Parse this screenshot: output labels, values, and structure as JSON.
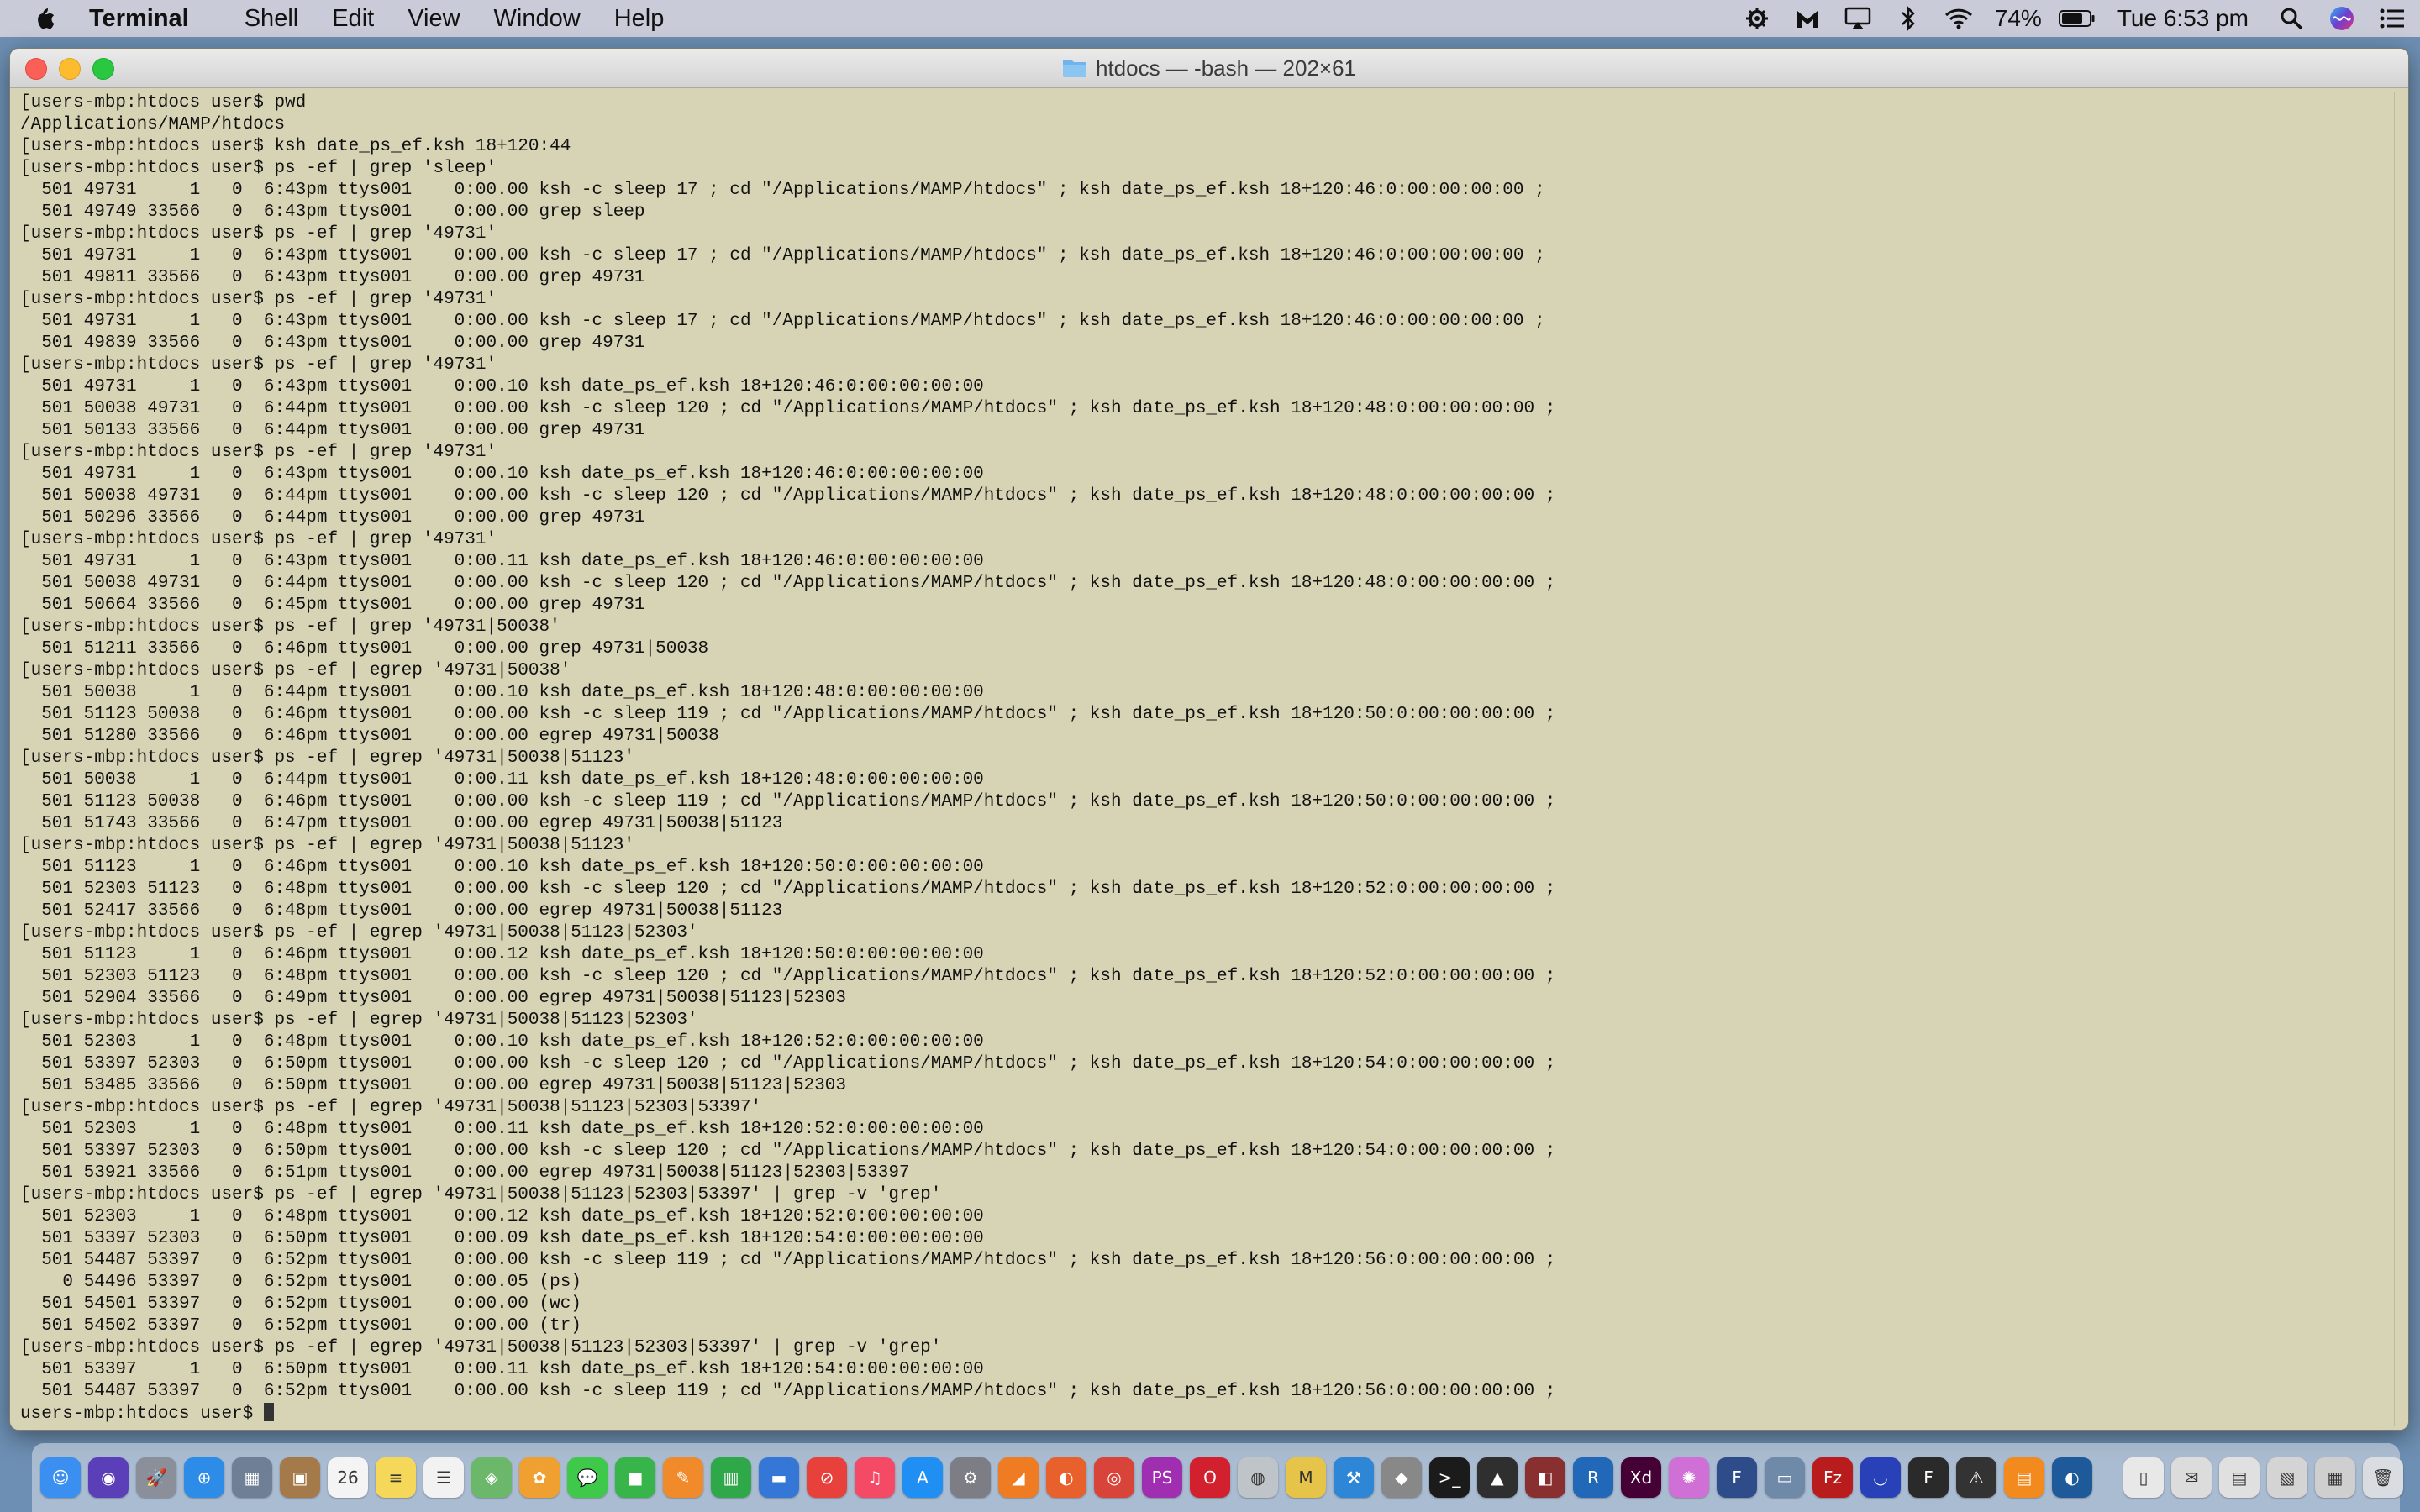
{
  "menubar": {
    "app_name": "Terminal",
    "menus": [
      "Shell",
      "Edit",
      "View",
      "Window",
      "Help"
    ],
    "battery": "74%",
    "clock": "Tue 6:53 pm",
    "status_icons": [
      "gear-status-icon",
      "malwarebytes-icon",
      "airplay-icon",
      "bluetooth-icon",
      "wifi-icon",
      "battery-icon",
      "spotlight-icon",
      "siri-icon",
      "notification-center-icon"
    ]
  },
  "window": {
    "title": "htdocs — -bash — 202×61"
  },
  "terminal": {
    "lines": [
      "[users-mbp:htdocs user$ pwd",
      "/Applications/MAMP/htdocs",
      "[users-mbp:htdocs user$ ksh date_ps_ef.ksh 18+120:44",
      "[users-mbp:htdocs user$ ps -ef | grep 'sleep'",
      "  501 49731     1   0  6:43pm ttys001    0:00.00 ksh -c sleep 17 ; cd \"/Applications/MAMP/htdocs\" ; ksh date_ps_ef.ksh 18+120:46:0:00:00:00:00 ;",
      "  501 49749 33566   0  6:43pm ttys001    0:00.00 grep sleep",
      "[users-mbp:htdocs user$ ps -ef | grep '49731'",
      "  501 49731     1   0  6:43pm ttys001    0:00.00 ksh -c sleep 17 ; cd \"/Applications/MAMP/htdocs\" ; ksh date_ps_ef.ksh 18+120:46:0:00:00:00:00 ;",
      "  501 49811 33566   0  6:43pm ttys001    0:00.00 grep 49731",
      "[users-mbp:htdocs user$ ps -ef | grep '49731'",
      "  501 49731     1   0  6:43pm ttys001    0:00.00 ksh -c sleep 17 ; cd \"/Applications/MAMP/htdocs\" ; ksh date_ps_ef.ksh 18+120:46:0:00:00:00:00 ;",
      "  501 49839 33566   0  6:43pm ttys001    0:00.00 grep 49731",
      "[users-mbp:htdocs user$ ps -ef | grep '49731'",
      "  501 49731     1   0  6:43pm ttys001    0:00.10 ksh date_ps_ef.ksh 18+120:46:0:00:00:00:00",
      "  501 50038 49731   0  6:44pm ttys001    0:00.00 ksh -c sleep 120 ; cd \"/Applications/MAMP/htdocs\" ; ksh date_ps_ef.ksh 18+120:48:0:00:00:00:00 ;",
      "  501 50133 33566   0  6:44pm ttys001    0:00.00 grep 49731",
      "[users-mbp:htdocs user$ ps -ef | grep '49731'",
      "  501 49731     1   0  6:43pm ttys001    0:00.10 ksh date_ps_ef.ksh 18+120:46:0:00:00:00:00",
      "  501 50038 49731   0  6:44pm ttys001    0:00.00 ksh -c sleep 120 ; cd \"/Applications/MAMP/htdocs\" ; ksh date_ps_ef.ksh 18+120:48:0:00:00:00:00 ;",
      "  501 50296 33566   0  6:44pm ttys001    0:00.00 grep 49731",
      "[users-mbp:htdocs user$ ps -ef | grep '49731'",
      "  501 49731     1   0  6:43pm ttys001    0:00.11 ksh date_ps_ef.ksh 18+120:46:0:00:00:00:00",
      "  501 50038 49731   0  6:44pm ttys001    0:00.00 ksh -c sleep 120 ; cd \"/Applications/MAMP/htdocs\" ; ksh date_ps_ef.ksh 18+120:48:0:00:00:00:00 ;",
      "  501 50664 33566   0  6:45pm ttys001    0:00.00 grep 49731",
      "[users-mbp:htdocs user$ ps -ef | grep '49731|50038'",
      "  501 51211 33566   0  6:46pm ttys001    0:00.00 grep 49731|50038",
      "[users-mbp:htdocs user$ ps -ef | egrep '49731|50038'",
      "  501 50038     1   0  6:44pm ttys001    0:00.10 ksh date_ps_ef.ksh 18+120:48:0:00:00:00:00",
      "  501 51123 50038   0  6:46pm ttys001    0:00.00 ksh -c sleep 119 ; cd \"/Applications/MAMP/htdocs\" ; ksh date_ps_ef.ksh 18+120:50:0:00:00:00:00 ;",
      "  501 51280 33566   0  6:46pm ttys001    0:00.00 egrep 49731|50038",
      "[users-mbp:htdocs user$ ps -ef | egrep '49731|50038|51123'",
      "  501 50038     1   0  6:44pm ttys001    0:00.11 ksh date_ps_ef.ksh 18+120:48:0:00:00:00:00",
      "  501 51123 50038   0  6:46pm ttys001    0:00.00 ksh -c sleep 119 ; cd \"/Applications/MAMP/htdocs\" ; ksh date_ps_ef.ksh 18+120:50:0:00:00:00:00 ;",
      "  501 51743 33566   0  6:47pm ttys001    0:00.00 egrep 49731|50038|51123",
      "[users-mbp:htdocs user$ ps -ef | egrep '49731|50038|51123'",
      "  501 51123     1   0  6:46pm ttys001    0:00.10 ksh date_ps_ef.ksh 18+120:50:0:00:00:00:00",
      "  501 52303 51123   0  6:48pm ttys001    0:00.00 ksh -c sleep 120 ; cd \"/Applications/MAMP/htdocs\" ; ksh date_ps_ef.ksh 18+120:52:0:00:00:00:00 ;",
      "  501 52417 33566   0  6:48pm ttys001    0:00.00 egrep 49731|50038|51123",
      "[users-mbp:htdocs user$ ps -ef | egrep '49731|50038|51123|52303'",
      "  501 51123     1   0  6:46pm ttys001    0:00.12 ksh date_ps_ef.ksh 18+120:50:0:00:00:00:00",
      "  501 52303 51123   0  6:48pm ttys001    0:00.00 ksh -c sleep 120 ; cd \"/Applications/MAMP/htdocs\" ; ksh date_ps_ef.ksh 18+120:52:0:00:00:00:00 ;",
      "  501 52904 33566   0  6:49pm ttys001    0:00.00 egrep 49731|50038|51123|52303",
      "[users-mbp:htdocs user$ ps -ef | egrep '49731|50038|51123|52303'",
      "  501 52303     1   0  6:48pm ttys001    0:00.10 ksh date_ps_ef.ksh 18+120:52:0:00:00:00:00",
      "  501 53397 52303   0  6:50pm ttys001    0:00.00 ksh -c sleep 120 ; cd \"/Applications/MAMP/htdocs\" ; ksh date_ps_ef.ksh 18+120:54:0:00:00:00:00 ;",
      "  501 53485 33566   0  6:50pm ttys001    0:00.00 egrep 49731|50038|51123|52303",
      "[users-mbp:htdocs user$ ps -ef | egrep '49731|50038|51123|52303|53397'",
      "  501 52303     1   0  6:48pm ttys001    0:00.11 ksh date_ps_ef.ksh 18+120:52:0:00:00:00:00",
      "  501 53397 52303   0  6:50pm ttys001    0:00.00 ksh -c sleep 120 ; cd \"/Applications/MAMP/htdocs\" ; ksh date_ps_ef.ksh 18+120:54:0:00:00:00:00 ;",
      "  501 53921 33566   0  6:51pm ttys001    0:00.00 egrep 49731|50038|51123|52303|53397",
      "[users-mbp:htdocs user$ ps -ef | egrep '49731|50038|51123|52303|53397' | grep -v 'grep'",
      "  501 52303     1   0  6:48pm ttys001    0:00.12 ksh date_ps_ef.ksh 18+120:52:0:00:00:00:00",
      "  501 53397 52303   0  6:50pm ttys001    0:00.09 ksh date_ps_ef.ksh 18+120:54:0:00:00:00:00",
      "  501 54487 53397   0  6:52pm ttys001    0:00.00 ksh -c sleep 119 ; cd \"/Applications/MAMP/htdocs\" ; ksh date_ps_ef.ksh 18+120:56:0:00:00:00:00 ;",
      "    0 54496 53397   0  6:52pm ttys001    0:00.05 (ps)",
      "  501 54501 53397   0  6:52pm ttys001    0:00.00 (wc)",
      "  501 54502 53397   0  6:52pm ttys001    0:00.00 (tr)",
      "[users-mbp:htdocs user$ ps -ef | egrep '49731|50038|51123|52303|53397' | grep -v 'grep'",
      "  501 53397     1   0  6:50pm ttys001    0:00.11 ksh date_ps_ef.ksh 18+120:54:0:00:00:00:00",
      "  501 54487 53397   0  6:52pm ttys001    0:00.00 ksh -c sleep 119 ; cd \"/Applications/MAMP/htdocs\" ; ksh date_ps_ef.ksh 18+120:56:0:00:00:00:00 ;"
    ],
    "prompt": "users-mbp:htdocs user$ "
  },
  "dock": {
    "apps": [
      {
        "name": "finder-icon",
        "color": "#3b8ff0",
        "glyph": "☺"
      },
      {
        "name": "siri-icon",
        "color": "#5a3fb8",
        "glyph": "◉"
      },
      {
        "name": "launchpad-icon",
        "color": "#8a8f9a",
        "glyph": "🚀"
      },
      {
        "name": "safari-icon",
        "color": "#2c8ce8",
        "glyph": "⊕"
      },
      {
        "name": "preview-icon",
        "color": "#6f7f95",
        "glyph": "▦"
      },
      {
        "name": "contacts-icon",
        "color": "#a57a4a",
        "glyph": "▣"
      },
      {
        "name": "calendar-icon",
        "color": "#f4f4f4",
        "glyph": "26"
      },
      {
        "name": "notes-icon",
        "color": "#f5d85a",
        "glyph": "≡"
      },
      {
        "name": "reminders-icon",
        "color": "#f2f2f2",
        "glyph": "☰"
      },
      {
        "name": "maps-icon",
        "color": "#6cb86a",
        "glyph": "◈"
      },
      {
        "name": "photos-icon",
        "color": "#f0a030",
        "glyph": "✿"
      },
      {
        "name": "messages-icon",
        "color": "#3ec94a",
        "glyph": "💬"
      },
      {
        "name": "facetime-icon",
        "color": "#38b54a",
        "glyph": "■"
      },
      {
        "name": "pages-icon",
        "color": "#f08a2a",
        "glyph": "✎"
      },
      {
        "name": "numbers-icon",
        "color": "#2fa84a",
        "glyph": "▥"
      },
      {
        "name": "keynote-icon",
        "color": "#3477d6",
        "glyph": "▬"
      },
      {
        "name": "news-icon",
        "color": "#e8403a",
        "glyph": "⊘"
      },
      {
        "name": "music-icon",
        "color": "#f44a66",
        "glyph": "♫"
      },
      {
        "name": "app-store-icon",
        "color": "#1f8ff4",
        "glyph": "A"
      },
      {
        "name": "system-preferences-icon",
        "color": "#7d7d85",
        "glyph": "⚙"
      },
      {
        "name": "anaconda-icon",
        "color": "#ef7c22",
        "glyph": "◢"
      },
      {
        "name": "firefox-icon",
        "color": "#e8602c",
        "glyph": "◐"
      },
      {
        "name": "chrome-icon",
        "color": "#d8443a",
        "glyph": "◎"
      },
      {
        "name": "phpstorm-icon",
        "color": "#a02eb0",
        "glyph": "PS"
      },
      {
        "name": "opera-icon",
        "color": "#d2202f",
        "glyph": "O"
      },
      {
        "name": "sequel-icon",
        "color": "#bfc4c9",
        "glyph": "◍"
      },
      {
        "name": "mamp-icon",
        "color": "#e6c44a",
        "glyph": "M"
      },
      {
        "name": "xcode-icon",
        "color": "#2d86d6",
        "glyph": "⚒"
      },
      {
        "name": "gimp-icon",
        "color": "#888888",
        "glyph": "◆"
      },
      {
        "name": "terminal-icon",
        "color": "#1b1b1b",
        "glyph": ">_"
      },
      {
        "name": "inkscape-icon",
        "color": "#2f2f2f",
        "glyph": "▲"
      },
      {
        "name": "filemerge-icon",
        "color": "#8a2f2f",
        "glyph": "◧"
      },
      {
        "name": "r-icon",
        "color": "#2268b8",
        "glyph": "R"
      },
      {
        "name": "adobe-xd-icon",
        "color": "#450135",
        "glyph": "Xd"
      },
      {
        "name": "color-picker-icon",
        "color": "#d06fd6",
        "glyph": "✺"
      },
      {
        "name": "framemaker-icon",
        "color": "#2f4c8a",
        "glyph": "F"
      },
      {
        "name": "image-capture-icon",
        "color": "#6f8aa8",
        "glyph": "▭"
      },
      {
        "name": "filezilla-icon",
        "color": "#b81c1c",
        "glyph": "Fz"
      },
      {
        "name": "audacity-icon",
        "color": "#2840b8",
        "glyph": "◡"
      },
      {
        "name": "fontforge-icon",
        "color": "#2a2a2a",
        "glyph": "F"
      },
      {
        "name": "console-icon",
        "color": "#333333",
        "glyph": "⚠"
      },
      {
        "name": "books-icon",
        "color": "#f28a1e",
        "glyph": "▤"
      },
      {
        "name": "cleaner-icon",
        "color": "#1e5a9a",
        "glyph": "◐"
      }
    ],
    "trash": [
      {
        "name": "document-stack-icon",
        "color": "#e8e8e8",
        "glyph": "▯"
      },
      {
        "name": "mail-stack-icon",
        "color": "#dcdcdc",
        "glyph": "✉"
      },
      {
        "name": "downloads-stack-icon",
        "color": "#e0e0e0",
        "glyph": "▤"
      },
      {
        "name": "screenshots-stack-icon",
        "color": "#d4d4d4",
        "glyph": "▧"
      },
      {
        "name": "files-stack-icon",
        "color": "#cfcfcf",
        "glyph": "▦"
      },
      {
        "name": "trash-icon",
        "color": "#d9dde2",
        "glyph": "🗑"
      }
    ]
  }
}
